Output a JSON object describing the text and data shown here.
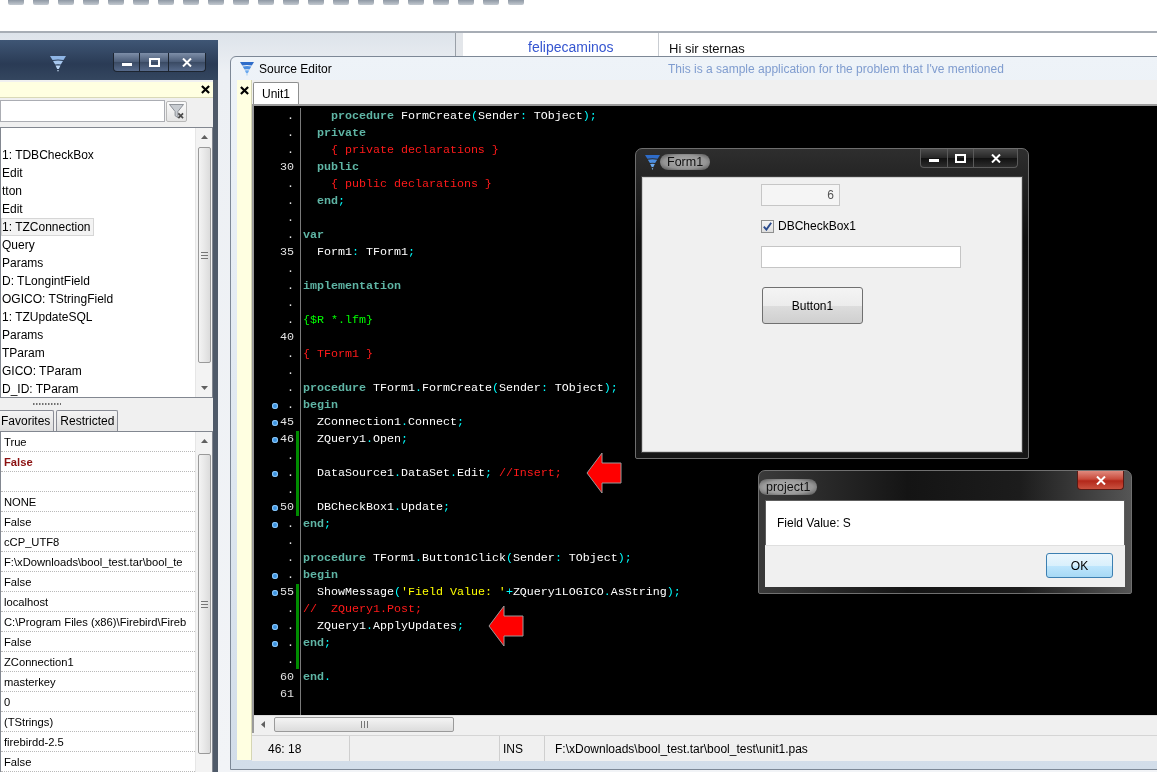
{
  "browser_page": {
    "link": "felipecaminos",
    "greeting": "Hi sir sternas",
    "message": "This is a sample application for the problem that I've mentioned"
  },
  "object_inspector": {
    "components": [
      {
        "label": "1: TDBCheckBox",
        "selected": false
      },
      {
        "label": "Edit",
        "selected": false
      },
      {
        "label": "tton",
        "selected": false
      },
      {
        "label": "Edit",
        "selected": false
      },
      {
        "label": "1: TZConnection",
        "selected": true
      },
      {
        "label": "Query",
        "selected": false
      },
      {
        "label": "Params",
        "selected": false
      },
      {
        "label": "D: TLongintField",
        "selected": false
      },
      {
        "label": "OGICO: TStringField",
        "selected": false
      },
      {
        "label": "1: TZUpdateSQL",
        "selected": false
      },
      {
        "label": "Params",
        "selected": false
      },
      {
        "label": "TParam",
        "selected": false
      },
      {
        "label": "GICO: TParam",
        "selected": false
      },
      {
        "label": "D_ID: TParam",
        "selected": false
      }
    ],
    "tabs": [
      {
        "label": "Favorites",
        "selected": false
      },
      {
        "label": "Restricted",
        "selected": false
      }
    ],
    "properties": [
      {
        "kind": "text",
        "value": "True",
        "modified": false
      },
      {
        "kind": "text",
        "value": "False",
        "modified": true
      },
      {
        "kind": "blank"
      },
      {
        "kind": "text",
        "value": "NONE",
        "modified": false
      },
      {
        "kind": "text",
        "value": "False",
        "modified": false
      },
      {
        "kind": "text",
        "value": "cCP_UTF8",
        "modified": false
      },
      {
        "kind": "text",
        "value": "F:\\xDownloads\\bool_test.tar\\bool_te",
        "modified": false
      },
      {
        "kind": "text",
        "value": "False",
        "modified": false
      },
      {
        "kind": "text",
        "value": "localhost",
        "modified": false
      },
      {
        "kind": "text",
        "value": "C:\\Program Files (x86)\\Firebird\\Fireb",
        "modified": false
      },
      {
        "kind": "text",
        "value": "False",
        "modified": false
      },
      {
        "kind": "text",
        "value": "ZConnection1",
        "modified": false
      },
      {
        "kind": "text",
        "value": "masterkey",
        "modified": false
      },
      {
        "kind": "text",
        "value": "0",
        "modified": false
      },
      {
        "kind": "text",
        "value": "(TStrings)",
        "modified": false
      },
      {
        "kind": "text",
        "value": "firebirdd-2.5",
        "modified": false
      },
      {
        "kind": "text",
        "value": "False",
        "modified": false
      }
    ]
  },
  "source_editor": {
    "title": "Source Editor",
    "tabs": [
      {
        "label": "Unit1",
        "selected": true
      }
    ],
    "lines": [
      {
        "gutter": ".",
        "executable": false,
        "modified": false,
        "arrow": false,
        "tokens": [
          {
            "kind": "keyword",
            "text": "    procedure"
          },
          {
            "kind": "ident",
            "text": " FormCreate"
          },
          {
            "kind": "symbol",
            "text": "("
          },
          {
            "kind": "ident",
            "text": "Sender"
          },
          {
            "kind": "symbol",
            "text": ":"
          },
          {
            "kind": "ident",
            "text": " TObject"
          },
          {
            "kind": "symbol",
            "text": ");"
          }
        ]
      },
      {
        "gutter": ".",
        "executable": false,
        "modified": false,
        "arrow": false,
        "tokens": [
          {
            "kind": "keyword",
            "text": "  private"
          }
        ]
      },
      {
        "gutter": ".",
        "executable": false,
        "modified": false,
        "arrow": false,
        "tokens": [
          {
            "kind": "comment",
            "text": "    { private declarations }"
          }
        ]
      },
      {
        "gutter": "30",
        "executable": false,
        "modified": false,
        "arrow": false,
        "tokens": [
          {
            "kind": "keyword",
            "text": "  public"
          }
        ]
      },
      {
        "gutter": ".",
        "executable": false,
        "modified": false,
        "arrow": false,
        "tokens": [
          {
            "kind": "comment",
            "text": "    { public declarations }"
          }
        ]
      },
      {
        "gutter": ".",
        "executable": false,
        "modified": false,
        "arrow": false,
        "tokens": [
          {
            "kind": "keyword",
            "text": "  end"
          },
          {
            "kind": "symbol",
            "text": ";"
          }
        ]
      },
      {
        "gutter": ".",
        "executable": false,
        "modified": false,
        "arrow": false
      },
      {
        "gutter": ".",
        "executable": false,
        "modified": false,
        "arrow": false,
        "tokens": [
          {
            "kind": "keyword",
            "text": "var"
          }
        ]
      },
      {
        "gutter": "35",
        "executable": false,
        "modified": false,
        "arrow": false,
        "tokens": [
          {
            "kind": "ident",
            "text": "  Form1"
          },
          {
            "kind": "symbol",
            "text": ":"
          },
          {
            "kind": "ident",
            "text": " TForm1"
          },
          {
            "kind": "symbol",
            "text": ";"
          }
        ]
      },
      {
        "gutter": ".",
        "executable": false,
        "modified": false,
        "arrow": false
      },
      {
        "gutter": ".",
        "executable": false,
        "modified": false,
        "arrow": false,
        "tokens": [
          {
            "kind": "keyword",
            "text": "implementation"
          }
        ]
      },
      {
        "gutter": ".",
        "executable": false,
        "modified": false,
        "arrow": false
      },
      {
        "gutter": ".",
        "executable": false,
        "modified": false,
        "arrow": false,
        "tokens": [
          {
            "kind": "directive",
            "text": "{$R *.lfm}"
          }
        ]
      },
      {
        "gutter": "40",
        "executable": false,
        "modified": false,
        "arrow": false
      },
      {
        "gutter": ".",
        "executable": false,
        "modified": false,
        "arrow": false,
        "tokens": [
          {
            "kind": "comment",
            "text": "{ TForm1 }"
          }
        ]
      },
      {
        "gutter": ".",
        "executable": false,
        "modified": false,
        "arrow": false
      },
      {
        "gutter": ".",
        "executable": false,
        "modified": false,
        "arrow": false,
        "tokens": [
          {
            "kind": "keyword",
            "text": "procedure"
          },
          {
            "kind": "ident",
            "text": " TForm1"
          },
          {
            "kind": "symbol",
            "text": "."
          },
          {
            "kind": "ident",
            "text": "FormCreate"
          },
          {
            "kind": "symbol",
            "text": "("
          },
          {
            "kind": "ident",
            "text": "Sender"
          },
          {
            "kind": "symbol",
            "text": ":"
          },
          {
            "kind": "ident",
            "text": " TObject"
          },
          {
            "kind": "symbol",
            "text": ");"
          }
        ]
      },
      {
        "gutter": ".",
        "executable": true,
        "modified": false,
        "arrow": false,
        "tokens": [
          {
            "kind": "keyword",
            "text": "begin"
          }
        ]
      },
      {
        "gutter": "45",
        "executable": true,
        "modified": false,
        "arrow": false,
        "tokens": [
          {
            "kind": "ident",
            "text": "  ZConnection1"
          },
          {
            "kind": "symbol",
            "text": "."
          },
          {
            "kind": "ident",
            "text": "Connect"
          },
          {
            "kind": "symbol",
            "text": ";"
          }
        ]
      },
      {
        "gutter": "46",
        "executable": true,
        "modified": true,
        "arrow": false,
        "tokens": [
          {
            "kind": "ident",
            "text": "  ZQuery1"
          },
          {
            "kind": "symbol",
            "text": "."
          },
          {
            "kind": "ident",
            "text": "Open"
          },
          {
            "kind": "symbol",
            "text": ";"
          }
        ]
      },
      {
        "gutter": ".",
        "executable": false,
        "modified": true,
        "arrow": false
      },
      {
        "gutter": ".",
        "executable": true,
        "modified": true,
        "arrow": true,
        "tokens": [
          {
            "kind": "ident",
            "text": "  DataSource1"
          },
          {
            "kind": "symbol",
            "text": "."
          },
          {
            "kind": "ident",
            "text": "DataSet"
          },
          {
            "kind": "symbol",
            "text": "."
          },
          {
            "kind": "ident",
            "text": "Edit"
          },
          {
            "kind": "symbol",
            "text": ";"
          },
          {
            "kind": "comment",
            "text": " //Insert;"
          }
        ]
      },
      {
        "gutter": ".",
        "executable": false,
        "modified": true,
        "arrow": false
      },
      {
        "gutter": "50",
        "executable": true,
        "modified": true,
        "arrow": false,
        "tokens": [
          {
            "kind": "ident",
            "text": "  DBCheckBox1"
          },
          {
            "kind": "symbol",
            "text": "."
          },
          {
            "kind": "ident",
            "text": "Update"
          },
          {
            "kind": "symbol",
            "text": ";"
          }
        ]
      },
      {
        "gutter": ".",
        "executable": true,
        "modified": false,
        "arrow": false,
        "tokens": [
          {
            "kind": "keyword",
            "text": "end"
          },
          {
            "kind": "symbol",
            "text": ";"
          }
        ]
      },
      {
        "gutter": ".",
        "executable": false,
        "modified": false,
        "arrow": false
      },
      {
        "gutter": ".",
        "executable": false,
        "modified": false,
        "arrow": false,
        "tokens": [
          {
            "kind": "keyword",
            "text": "procedure"
          },
          {
            "kind": "ident",
            "text": " TForm1"
          },
          {
            "kind": "symbol",
            "text": "."
          },
          {
            "kind": "ident",
            "text": "Button1Click"
          },
          {
            "kind": "symbol",
            "text": "("
          },
          {
            "kind": "ident",
            "text": "Sender"
          },
          {
            "kind": "symbol",
            "text": ":"
          },
          {
            "kind": "ident",
            "text": " TObject"
          },
          {
            "kind": "symbol",
            "text": ");"
          }
        ]
      },
      {
        "gutter": ".",
        "executable": true,
        "modified": false,
        "arrow": false,
        "tokens": [
          {
            "kind": "keyword",
            "text": "begin"
          }
        ]
      },
      {
        "gutter": "55",
        "executable": true,
        "modified": true,
        "arrow": false,
        "tokens": [
          {
            "kind": "ident",
            "text": "  ShowMessage"
          },
          {
            "kind": "symbol",
            "text": "("
          },
          {
            "kind": "string",
            "text": "'Field Value: '"
          },
          {
            "kind": "symbol",
            "text": "+"
          },
          {
            "kind": "ident",
            "text": "ZQuery1LOGICO"
          },
          {
            "kind": "symbol",
            "text": "."
          },
          {
            "kind": "ident",
            "text": "AsString"
          },
          {
            "kind": "symbol",
            "text": ");"
          }
        ]
      },
      {
        "gutter": ".",
        "executable": false,
        "modified": true,
        "arrow": false,
        "tokens": [
          {
            "kind": "comment",
            "text": "//  ZQuery1.Post;"
          }
        ]
      },
      {
        "gutter": ".",
        "executable": true,
        "modified": true,
        "arrow": true,
        "tokens": [
          {
            "kind": "ident",
            "text": "  ZQuery1"
          },
          {
            "kind": "symbol",
            "text": "."
          },
          {
            "kind": "ident",
            "text": "ApplyUpdates"
          },
          {
            "kind": "symbol",
            "text": ";"
          }
        ]
      },
      {
        "gutter": ".",
        "executable": true,
        "modified": true,
        "arrow": false,
        "tokens": [
          {
            "kind": "keyword",
            "text": "end"
          },
          {
            "kind": "symbol",
            "text": ";"
          }
        ]
      },
      {
        "gutter": ".",
        "executable": false,
        "modified": true,
        "arrow": false
      },
      {
        "gutter": "60",
        "executable": false,
        "modified": false,
        "arrow": false,
        "tokens": [
          {
            "kind": "keyword",
            "text": "end"
          },
          {
            "kind": "symbol",
            "text": "."
          }
        ]
      },
      {
        "gutter": "61",
        "executable": false,
        "modified": false,
        "arrow": false
      }
    ],
    "status_bar": {
      "position": "46: 18",
      "mode": "INS",
      "file": "F:\\xDownloads\\bool_test.tar\\bool_test\\unit1.pas"
    }
  },
  "form_window": {
    "title": "Form1",
    "number_field": {
      "value": "6",
      "disabled": true
    },
    "checkbox": {
      "label": "DBCheckBox1",
      "checked": true
    },
    "button": "Button1"
  },
  "message_dialog": {
    "title": "project1",
    "message": "Field Value: S",
    "button": "OK"
  }
}
